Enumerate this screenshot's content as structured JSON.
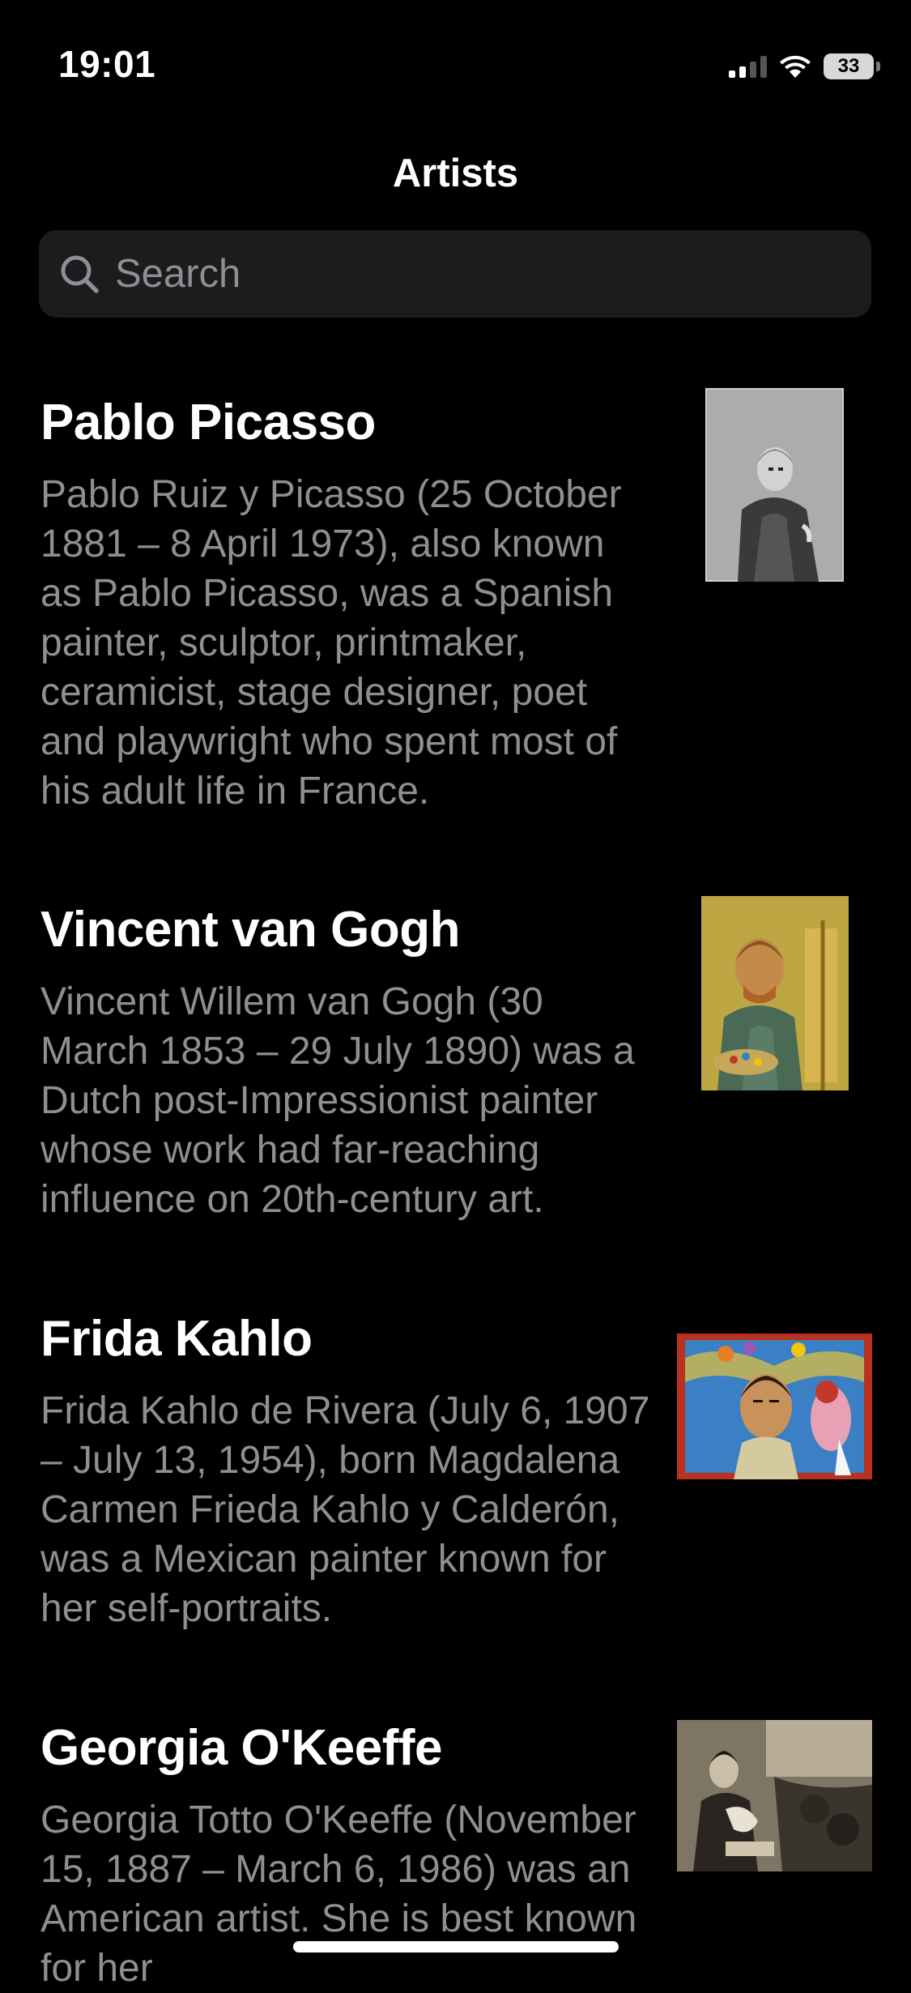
{
  "status_bar": {
    "time": "19:01",
    "battery": "33"
  },
  "nav": {
    "title": "Artists"
  },
  "search": {
    "placeholder": "Search"
  },
  "artists": [
    {
      "name": "Pablo Picasso",
      "description": "Pablo Ruiz y Picasso (25 October 1881 – 8 April 1973), also known as Pablo Picasso, was a Spanish painter, sculptor, printmaker, ceramicist, stage designer, poet and playwright who spent most of his adult life in France."
    },
    {
      "name": "Vincent van Gogh",
      "description": "Vincent Willem van Gogh (30 March 1853 – 29 July 1890) was a Dutch post-Impressionist painter whose work had far-reaching influence on 20th-century art."
    },
    {
      "name": "Frida Kahlo",
      "description": "Frida Kahlo de Rivera (July 6, 1907 – July 13, 1954), born Magdalena Carmen Frieda Kahlo y Calderón, was a Mexican painter known for her self-portraits."
    },
    {
      "name": "Georgia O'Keeffe",
      "description": "Georgia Totto O'Keeffe (November 15, 1887 – March 6, 1986) was an American artist. She is best known for her"
    }
  ],
  "colors": {
    "background": "#000000",
    "search_field": "#1c1c1e",
    "secondary_text": "#8e8e93"
  }
}
